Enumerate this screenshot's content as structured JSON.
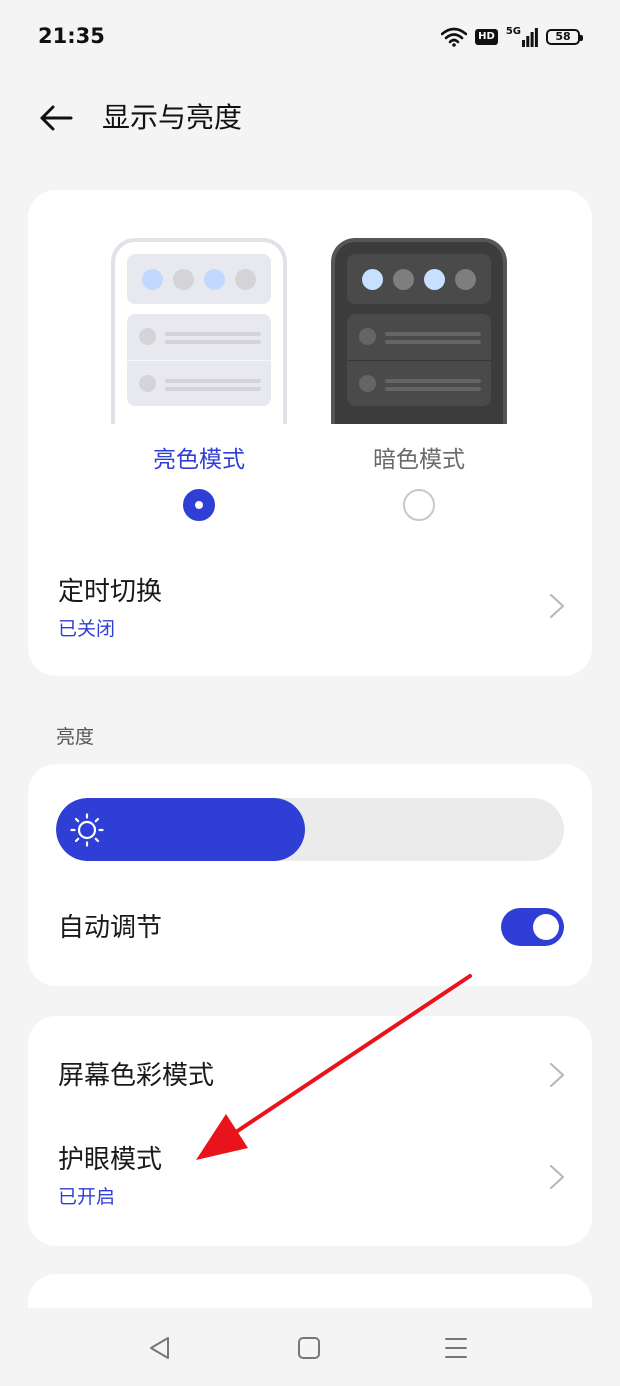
{
  "status_bar": {
    "time": "21:35",
    "hd_badge": "HD",
    "network": "5G",
    "battery": "58"
  },
  "header": {
    "title": "显示与亮度"
  },
  "theme": {
    "light_label": "亮色模式",
    "dark_label": "暗色模式",
    "selected": "light"
  },
  "schedule": {
    "title": "定时切换",
    "status": "已关闭"
  },
  "brightness": {
    "section_label": "亮度",
    "level": 0.49,
    "auto_label": "自动调节",
    "auto_enabled": true
  },
  "display": {
    "color_mode_title": "屏幕色彩模式",
    "eye_care_title": "护眼模式",
    "eye_care_status": "已开启"
  },
  "colors": {
    "accent": "#2f3fd6",
    "background": "#f4f4f4",
    "card": "#ffffff",
    "annotation_arrow": "#e8131b"
  },
  "icons": {
    "back": "arrow-left-icon",
    "wifi": "wifi-icon",
    "signal": "signal-icon",
    "battery": "battery-icon",
    "chevron": "chevron-right-icon",
    "sun": "sun-icon",
    "nav_back": "triangle-back-icon",
    "nav_home": "square-home-icon",
    "nav_menu": "menu-lines-icon"
  }
}
